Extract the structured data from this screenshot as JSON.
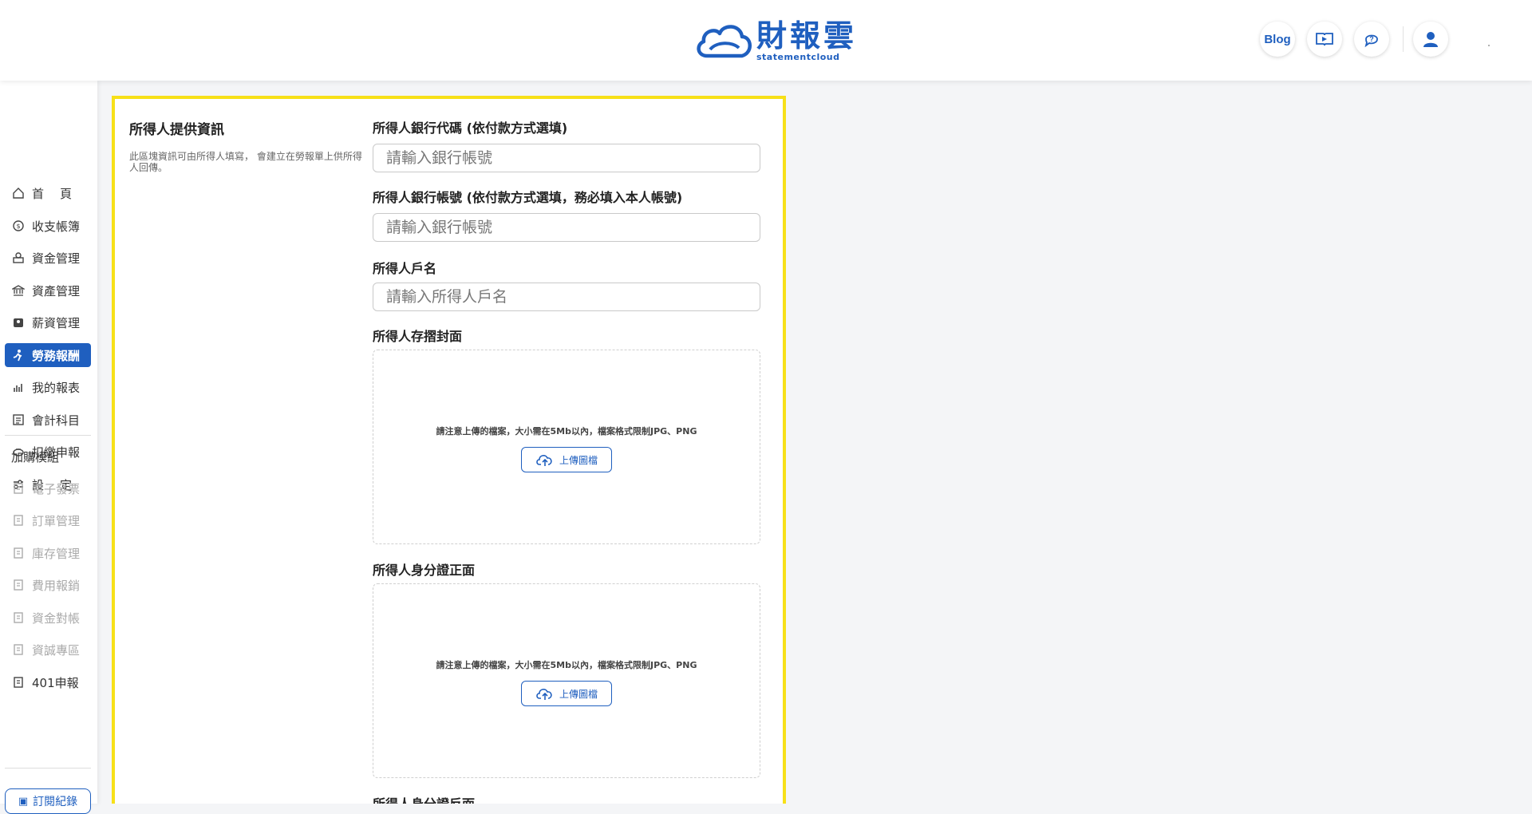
{
  "header": {
    "logo_zh": "財報雲",
    "logo_en": "statementcloud",
    "blog_label": "Blog",
    "icons": [
      "video-tutorial-icon",
      "help-chat-icon",
      "user-icon"
    ]
  },
  "sidebar": {
    "items": [
      {
        "label": "首頁",
        "icon": "home-icon"
      },
      {
        "label": "收支帳簿",
        "icon": "cashbook-icon"
      },
      {
        "label": "資金管理",
        "icon": "funds-icon"
      },
      {
        "label": "資產管理",
        "icon": "asset-icon"
      },
      {
        "label": "薪資管理",
        "icon": "payroll-icon"
      },
      {
        "label": "勞務報酬",
        "icon": "labor-icon"
      },
      {
        "label": "我的報表",
        "icon": "report-icon"
      },
      {
        "label": "會計科目",
        "icon": "account-icon"
      },
      {
        "label": "扣繳申報",
        "icon": "withholding-icon"
      },
      {
        "label": "設定",
        "icon": "settings-icon"
      }
    ],
    "addon_title": "加購模組",
    "addons": [
      {
        "label": "電子發票"
      },
      {
        "label": "訂單管理"
      },
      {
        "label": "庫存管理"
      },
      {
        "label": "費用報銷"
      },
      {
        "label": "資金對帳"
      },
      {
        "label": "資誠專區"
      },
      {
        "label": "401申報"
      }
    ],
    "subscription_label": "訂閱紀錄"
  },
  "section": {
    "title": "所得人提供資訊",
    "description": "此區塊資訊可由所得人填寫， 會建立在勞報單上供所得人回傳。"
  },
  "form": {
    "bank_code_label": "所得人銀行代碼 (依付款方式選填)",
    "bank_code_placeholder": "請輸入銀行帳號",
    "bank_account_label": "所得人銀行帳號 (依付款方式選填，務必填入本人帳號)",
    "bank_account_placeholder": "請輸入銀行帳號",
    "account_name_label": "所得人戶名",
    "account_name_placeholder": "請輸入所得人戶名",
    "passbook_label": "所得人存摺封面",
    "id_front_label": "所得人身分證正面",
    "id_back_label": "所得人身分證反面",
    "upload_note": "請注意上傳的檔案，大小需在5Mb以內，檔案格式限制JPG、PNG",
    "upload_button": "上傳圖檔"
  },
  "colors": {
    "brand": "#1f5fbf",
    "highlight": "#f7e018"
  }
}
